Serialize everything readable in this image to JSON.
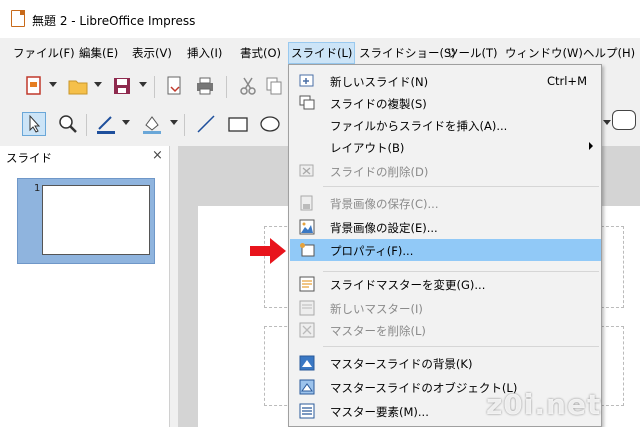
{
  "window": {
    "title": "無題 2 - LibreOffice Impress"
  },
  "menubar": {
    "items": [
      {
        "label": "ファイル(F)"
      },
      {
        "label": "編集(E)"
      },
      {
        "label": "表示(V)"
      },
      {
        "label": "挿入(I)"
      },
      {
        "label": "書式(O)"
      },
      {
        "label": "スライド(L)",
        "active": true
      },
      {
        "label": "スライドショー(S)"
      },
      {
        "label": "ツール(T)"
      },
      {
        "label": "ウィンドウ(W)"
      },
      {
        "label": "ヘルプ(H)"
      }
    ]
  },
  "slide_panel": {
    "title": "スライド",
    "close": "×",
    "slide_number": "1"
  },
  "slide_menu": {
    "items": [
      {
        "label": "新しいスライド(N)",
        "accel": "Ctrl+M",
        "icon": "new-slide-icon"
      },
      {
        "label": "スライドの複製(S)",
        "icon": "duplicate-slide-icon"
      },
      {
        "label": "ファイルからスライドを挿入(A)...",
        "icon": ""
      },
      {
        "label": "レイアウト(B)",
        "submenu": true,
        "icon": ""
      },
      {
        "label": "スライドの削除(D)",
        "disabled": true,
        "icon": "delete-slide-icon"
      },
      {
        "label": "背景画像の保存(C)...",
        "disabled": true,
        "icon": "save-bg-image-icon"
      },
      {
        "label": "背景画像の設定(E)...",
        "icon": "set-bg-image-icon"
      },
      {
        "label": "プロパティ(F)...",
        "highlighted": true,
        "icon": "properties-icon"
      },
      {
        "label": "スライドマスターを変更(G)...",
        "icon": "change-master-icon"
      },
      {
        "label": "新しいマスター(I)",
        "disabled": true,
        "icon": "new-master-icon"
      },
      {
        "label": "マスターを削除(L)",
        "disabled": true,
        "icon": "delete-master-icon"
      },
      {
        "label": "マスタースライドの背景(K)",
        "icon": "master-bg-icon"
      },
      {
        "label": "マスタースライドのオブジェクト(L)",
        "icon": "master-objects-icon"
      },
      {
        "label": "マスター要素(M)...",
        "icon": "master-elements-icon"
      }
    ]
  },
  "watermark": "z0i.net",
  "colors": {
    "highlight": "#91c9f7",
    "menu_active": "#cce4f7",
    "arrow": "#e8141c",
    "panel_thumb": "#8fb4de"
  }
}
